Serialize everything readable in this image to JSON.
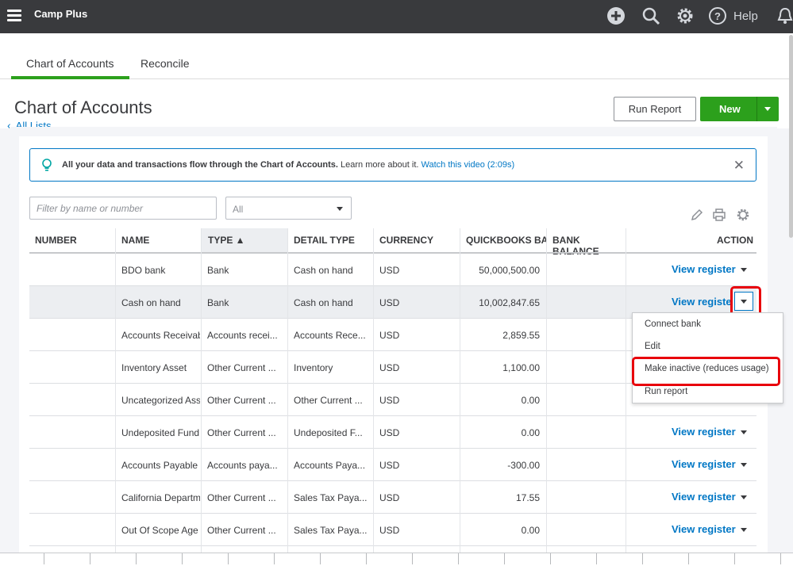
{
  "topbar": {
    "company": "Camp Plus",
    "icons": [
      "menu-icon",
      "plus-icon",
      "search-icon",
      "gear-icon",
      "help-icon",
      "bell-icon"
    ],
    "help_label": "Help"
  },
  "tabs": [
    {
      "label": "Chart of Accounts",
      "active": true
    },
    {
      "label": "Reconcile",
      "active": false
    }
  ],
  "page": {
    "title": "Chart of Accounts",
    "back_link": "All Lists",
    "run_report_label": "Run Report",
    "new_label": "New"
  },
  "info": {
    "bold_text": "All your data and transactions flow through the Chart of Accounts.",
    "text": "Learn more about it.",
    "link": "Watch this video (2:09s)"
  },
  "filters": {
    "search_placeholder": "Filter by name or number",
    "select_value": "All"
  },
  "table": {
    "headers": [
      "NUMBER",
      "NAME",
      "TYPE ▲",
      "DETAIL TYPE",
      "CURRENCY",
      "QUICKBOOKS BAL",
      "BANK BALANCE",
      "ACTION"
    ],
    "action_label": "View register",
    "rows": [
      {
        "number": "",
        "name": "BDO bank",
        "type": "Bank",
        "detail": "Cash on hand",
        "currency": "USD",
        "qb": "50,000,500.00",
        "bank": "",
        "action": "View register"
      },
      {
        "number": "",
        "name": "Cash on hand",
        "type": "Bank",
        "detail": "Cash on hand",
        "currency": "USD",
        "qb": "10,002,847.65",
        "bank": "",
        "action": "View registe"
      },
      {
        "number": "",
        "name": "Accounts Receivab",
        "type": "Accounts recei...",
        "detail": "Accounts Rece...",
        "currency": "USD",
        "qb": "2,859.55",
        "bank": "",
        "action": ""
      },
      {
        "number": "",
        "name": "Inventory Asset",
        "type": "Other Current ...",
        "detail": "Inventory",
        "currency": "USD",
        "qb": "1,100.00",
        "bank": "",
        "action": ""
      },
      {
        "number": "",
        "name": "Uncategorized Ass",
        "type": "Other Current ...",
        "detail": "Other Current ...",
        "currency": "USD",
        "qb": "0.00",
        "bank": "",
        "action": ""
      },
      {
        "number": "",
        "name": "Undeposited Fund",
        "type": "Other Current ...",
        "detail": "Undeposited F...",
        "currency": "USD",
        "qb": "0.00",
        "bank": "",
        "action": "View register"
      },
      {
        "number": "",
        "name": "Accounts Payable (",
        "type": "Accounts paya...",
        "detail": "Accounts Paya...",
        "currency": "USD",
        "qb": "-300.00",
        "bank": "",
        "action": "View register"
      },
      {
        "number": "",
        "name": "California Departm",
        "type": "Other Current ...",
        "detail": "Sales Tax Paya...",
        "currency": "USD",
        "qb": "17.55",
        "bank": "",
        "action": "View register"
      },
      {
        "number": "",
        "name": "Out Of Scope Age",
        "type": "Other Current ...",
        "detail": "Sales Tax Paya...",
        "currency": "USD",
        "qb": "0.00",
        "bank": "",
        "action": "View register"
      }
    ]
  },
  "action_menu": {
    "items": [
      "Connect bank",
      "Edit",
      "Make inactive (reduces usage)",
      "Run report"
    ]
  },
  "colors": {
    "topbar": "#393a3d",
    "accent_green": "#2ca01c",
    "link_blue": "#0077c5",
    "highlight_red": "#e8000b"
  }
}
